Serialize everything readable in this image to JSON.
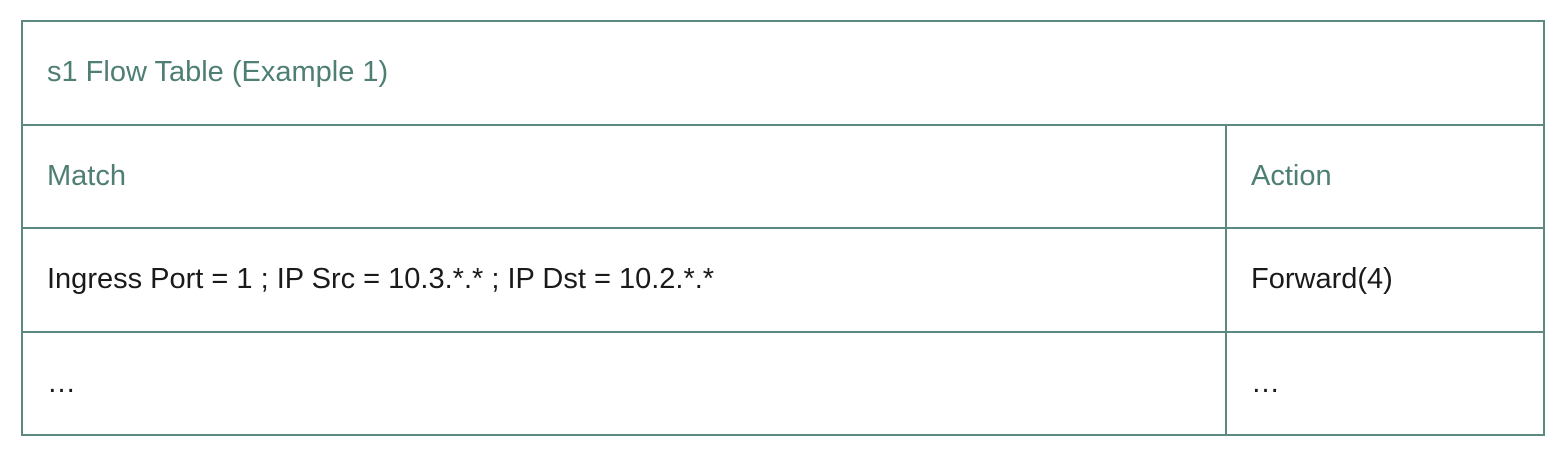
{
  "table": {
    "title": "s1 Flow Table (Example 1)",
    "headers": {
      "match": "Match",
      "action": "Action"
    },
    "rows": [
      {
        "match": "Ingress Port = 1 ; IP Src = 10.3.*.* ; IP Dst = 10.2.*.*",
        "action": "Forward(4)"
      },
      {
        "match": "…",
        "action": "…"
      }
    ]
  },
  "colors": {
    "border": "#5d8a80",
    "title_text": "#4f7e74",
    "body_text": "#1a1a1a"
  }
}
